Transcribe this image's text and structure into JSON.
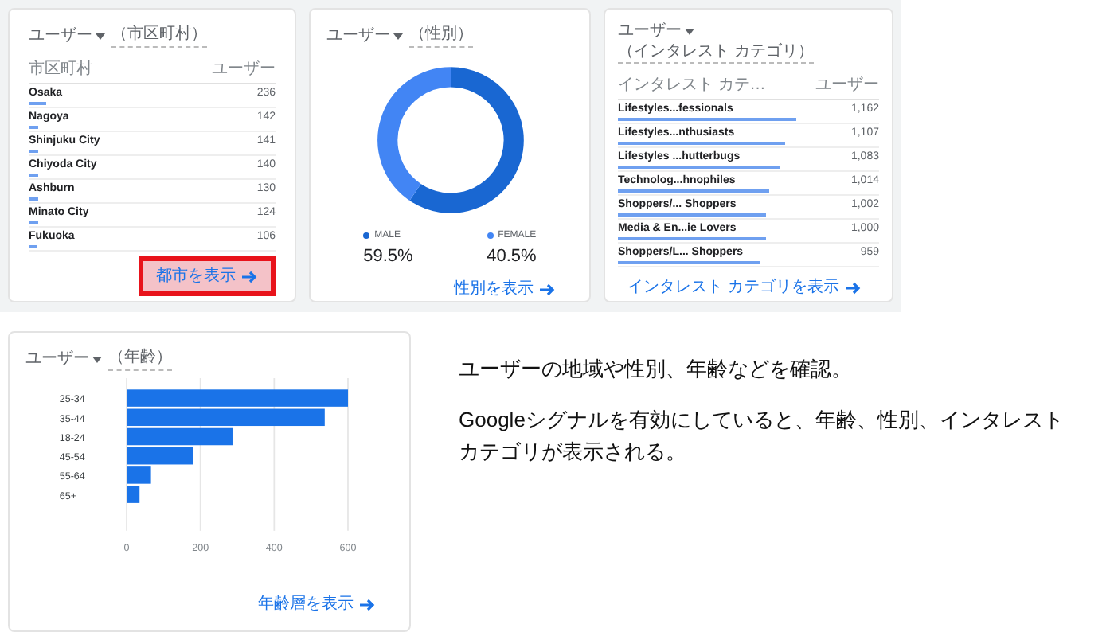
{
  "city_card": {
    "metric": "ユーザー",
    "dimension": "（市区町村）",
    "column_1": "市区町村",
    "column_2": "ユーザー",
    "rows": [
      {
        "name": "Osaka",
        "value": "236",
        "level": 0.07
      },
      {
        "name": "Nagoya",
        "value": "142",
        "level": 0.04
      },
      {
        "name": "Shinjuku City",
        "value": "141",
        "level": 0.04
      },
      {
        "name": "Chiyoda City",
        "value": "140",
        "level": 0.04
      },
      {
        "name": "Ashburn",
        "value": "130",
        "level": 0.04
      },
      {
        "name": "Minato City",
        "value": "124",
        "level": 0.04
      },
      {
        "name": "Fukuoka",
        "value": "106",
        "level": 0.03
      }
    ],
    "link": {
      "label": "都市を表示",
      "highlighted": true
    }
  },
  "gender_card": {
    "metric": "ユーザー",
    "dimension": "（性別）",
    "segments": [
      {
        "label": "MALE",
        "value": "59.5%",
        "color": "#1967d2"
      },
      {
        "label": "FEMALE",
        "value": "40.5%",
        "color": "#4285f4"
      }
    ],
    "link": {
      "label": "性別を表示",
      "highlighted": false
    }
  },
  "interest_card": {
    "metric": "ユーザー",
    "dimension": "（インタレスト カテゴリ）",
    "column_1": "インタレスト カテ…",
    "column_2": "ユーザー",
    "rows": [
      {
        "name": "Lifestyles...fessionals",
        "value": "1,162",
        "level": 0.68
      },
      {
        "name": "Lifestyles...nthusiasts",
        "value": "1,107",
        "level": 0.64
      },
      {
        "name": "Lifestyles ...hutterbugs",
        "value": "1,083",
        "level": 0.62
      },
      {
        "name": "Technolog...hnophiles",
        "value": "1,014",
        "level": 0.58
      },
      {
        "name": "Shoppers/... Shoppers",
        "value": "1,002",
        "level": 0.57
      },
      {
        "name": "Media & En...ie Lovers",
        "value": "1,000",
        "level": 0.57
      },
      {
        "name": "Shoppers/L... Shoppers",
        "value": "959",
        "level": 0.54
      }
    ],
    "link": {
      "label": "インタレスト カテゴリを表示",
      "highlighted": false
    }
  },
  "age_card": {
    "metric": "ユーザー",
    "dimension": "（年齢）",
    "chart_data": {
      "type": "bar",
      "orientation": "horizontal",
      "categories": [
        "25-34",
        "35-44",
        "18-24",
        "45-54",
        "55-64",
        "65+"
      ],
      "series": [
        {
          "color": "#1a73e8",
          "values": [
            600,
            537,
            287,
            180,
            66,
            35
          ]
        }
      ],
      "xlim": [
        0,
        600
      ],
      "xticks": [
        0,
        200,
        400,
        600
      ],
      "grid": true
    },
    "link": {
      "label": "年齢層を表示",
      "highlighted": false
    }
  },
  "notes": [
    "ユーザーの地域や性別、年齢などを確認。",
    "Googleシグナルを有効にしていると、年齢、性別、インタレストカテゴリが表示される。"
  ]
}
